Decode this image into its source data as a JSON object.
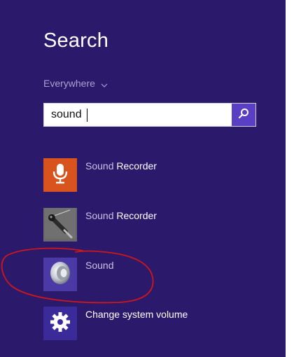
{
  "search": {
    "title": "Search",
    "scope": "Everywhere",
    "query": "sound"
  },
  "results": [
    {
      "match": "Sound",
      "rest": " Recorder",
      "icon": "microphone-icon"
    },
    {
      "match": "Sound",
      "rest": " Recorder",
      "icon": "legacy-microphone-icon"
    },
    {
      "match": "Sound",
      "rest": "",
      "icon": "speaker-icon"
    },
    {
      "match": "Change system volume",
      "rest": "",
      "icon": "gear-icon"
    }
  ],
  "colors": {
    "panel_background": "#2b1a6b",
    "search_button": "#5a3fc4",
    "annotation_circle": "#d0161a"
  }
}
